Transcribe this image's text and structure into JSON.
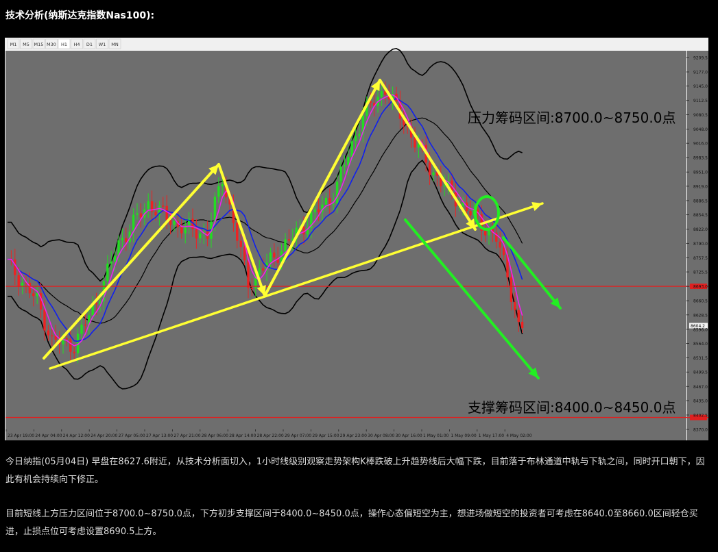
{
  "heading": "技术分析(纳斯达克指数Nas100):",
  "paragraphs": [
    "今日纳指(05月04日) 早盘在8627.6附近，从技术分析面切入，1小时线级别观察走势架构K棒跌破上升趋势线后大幅下跌，目前落于布林通道中轨与下轨之间，同时开口朝下，因此有机会持续向下修正。",
    "目前短线上方压力区间位于8700.0~8750.0点，下方初步支撑区间于8400.0~8450.0点，操作心态偏短空为主，想进场做短空的投资者可考虑在8640.0至8660.0区间轻仓买进，止损点位可考虑设置8690.5上方。"
  ],
  "colors": {
    "chart_bg": "#6e6e6e",
    "toolbar_bg": "#f0f0f0",
    "arrow_yellow": "#ffff33",
    "arrow_green": "#22ee22",
    "level_red": "#e02020",
    "bull_candle": "#22dd22",
    "bear_candle": "#ee2222",
    "ma_blue": "#1020ee",
    "ma_magenta": "#ee22ee",
    "bollinger": "#000000"
  },
  "chart_data": {
    "type": "candlestick",
    "timeframes": [
      "M1",
      "M5",
      "M15",
      "M30",
      "H1",
      "H4",
      "D1",
      "W1",
      "MN"
    ],
    "active_timeframe": "H1",
    "y_ticks": [
      9209.5,
      9177.0,
      9145.0,
      9112.5,
      9080.5,
      9048.0,
      9016.0,
      8983.5,
      8951.0,
      8919.0,
      8886.5,
      8854.5,
      8822.0,
      8790.0,
      8757.5,
      8725.5,
      8693.0,
      8660.5,
      8628.5,
      8596.0,
      8564.0,
      8531.5,
      8499.5,
      8467.0,
      8435.0,
      8402.5,
      8370.0
    ],
    "ylim": [
      8360,
      9225
    ],
    "x_labels": [
      "23 Apr 19:00",
      "24 Apr 04:00",
      "24 Apr 12:00",
      "24 Apr 20:00",
      "27 Apr 05:00",
      "27 Apr 13:00",
      "27 Apr 21:00",
      "28 Apr 06:00",
      "28 Apr 14:00",
      "28 Apr 22:00",
      "29 Apr 07:00",
      "29 Apr 15:00",
      "29 Apr 23:00",
      "30 Apr 08:00",
      "30 Apr 16:00",
      "1 May 01:00",
      "1 May 09:00",
      "1 May 17:00",
      "4 May 02:00"
    ],
    "bars": 140,
    "close_pivots": [
      [
        0,
        8745
      ],
      [
        8,
        8660
      ],
      [
        12,
        8570
      ],
      [
        18,
        8560
      ],
      [
        24,
        8660
      ],
      [
        30,
        8790
      ],
      [
        38,
        8880
      ],
      [
        46,
        8830
      ],
      [
        54,
        8810
      ],
      [
        58,
        8940
      ],
      [
        65,
        8700
      ],
      [
        72,
        8760
      ],
      [
        80,
        8830
      ],
      [
        88,
        8900
      ],
      [
        96,
        9080
      ],
      [
        102,
        9140
      ],
      [
        108,
        9050
      ],
      [
        114,
        8960
      ],
      [
        120,
        8900
      ],
      [
        126,
        8850
      ],
      [
        132,
        8800
      ],
      [
        135,
        8720
      ],
      [
        138,
        8600
      ],
      [
        139,
        8600
      ]
    ],
    "current_price": 8604.2,
    "red_levels": [
      8693.0,
      8397.0
    ],
    "resistance_label": "压力筹码区间:8700.0~8750.0点",
    "support_label": "支撑筹码区间:8400.0~8450.0点"
  }
}
